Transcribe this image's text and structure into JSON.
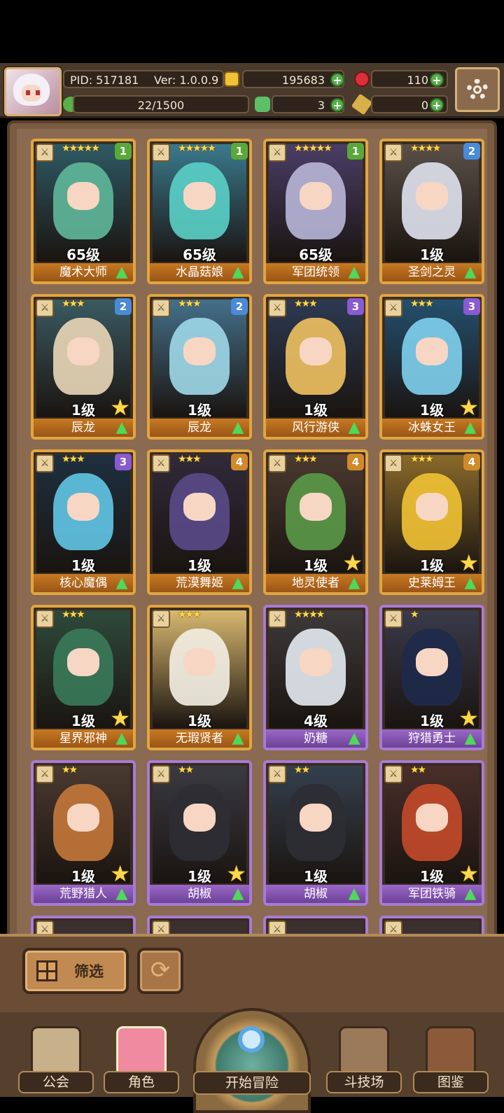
{
  "header": {
    "pid": "PID: 517181",
    "version": "Ver: 1.0.0.9",
    "energy": "22/1500",
    "gold": "195683",
    "gems": "110",
    "clover": "3",
    "keys": "0"
  },
  "roster": [
    {
      "stars": "★★★★★",
      "rank": "1",
      "rank_color": "#5aa83a",
      "level": "65级",
      "name": "魔术大师",
      "frame": "gold",
      "art": "#2e5a64",
      "char": "#5fb89a",
      "big_star": false
    },
    {
      "stars": "★★★★★",
      "rank": "1",
      "rank_color": "#5aa83a",
      "level": "65级",
      "name": "水晶菇娘",
      "frame": "gold",
      "art": "#3a7a8e",
      "char": "#5ad0c8",
      "big_star": false
    },
    {
      "stars": "★★★★★",
      "rank": "1",
      "rank_color": "#5aa83a",
      "level": "65级",
      "name": "军团统领",
      "frame": "gold",
      "art": "#4a3e66",
      "char": "#b8b6d8",
      "big_star": false
    },
    {
      "stars": "★★★★",
      "rank": "2",
      "rank_color": "#4a8ad6",
      "level": "1级",
      "name": "圣剑之灵",
      "frame": "gold",
      "art": "#5a5048",
      "char": "#dfe3ee",
      "big_star": false
    },
    {
      "stars": "★★★",
      "rank": "2",
      "rank_color": "#4a8ad6",
      "level": "1级",
      "name": "辰龙",
      "frame": "gold",
      "art": "#3a5a62",
      "char": "#ead7b8",
      "big_star": true
    },
    {
      "stars": "★★★",
      "rank": "2",
      "rank_color": "#4a8ad6",
      "level": "1级",
      "name": "辰龙",
      "frame": "gold",
      "art": "#44708a",
      "char": "#9fd8e8",
      "big_star": false
    },
    {
      "stars": "★★★",
      "rank": "3",
      "rank_color": "#8a5ad0",
      "level": "1级",
      "name": "风行游侠",
      "frame": "gold",
      "art": "#2c3a52",
      "char": "#f0c260",
      "big_star": false
    },
    {
      "stars": "★★★",
      "rank": "3",
      "rank_color": "#8a5ad0",
      "level": "1级",
      "name": "冰蛛女王",
      "frame": "gold",
      "art": "#24506e",
      "char": "#7fd0ee",
      "big_star": true
    },
    {
      "stars": "★★★",
      "rank": "3",
      "rank_color": "#8a5ad0",
      "level": "1级",
      "name": "核心魔偶",
      "frame": "gold",
      "art": "#1e3040",
      "char": "#62c6e6",
      "big_star": false
    },
    {
      "stars": "★★★",
      "rank": "4",
      "rank_color": "#d08a2a",
      "level": "1级",
      "name": "荒漠舞姬",
      "frame": "gold",
      "art": "#302a3a",
      "char": "#5a4a8a",
      "big_star": false
    },
    {
      "stars": "★★★",
      "rank": "4",
      "rank_color": "#d08a2a",
      "level": "1级",
      "name": "地灵使者",
      "frame": "gold",
      "art": "#4a3a30",
      "char": "#5a9a48",
      "big_star": true
    },
    {
      "stars": "★★★",
      "rank": "4",
      "rank_color": "#d08a2a",
      "level": "1级",
      "name": "史莱姆王",
      "frame": "gold",
      "art": "#8a6a2a",
      "char": "#f2c234",
      "big_star": true
    },
    {
      "stars": "★★★",
      "rank": "",
      "rank_color": "#3a3a6a",
      "level": "1级",
      "name": "星界邪神",
      "frame": "gold",
      "art": "#2e4a3a",
      "char": "#3a7a5a",
      "big_star": true
    },
    {
      "stars": "★★★",
      "rank": "",
      "rank_color": "",
      "level": "1级",
      "name": "无瑕贤者",
      "frame": "gold",
      "art": "#d8b870",
      "char": "#f4efe6",
      "big_star": false
    },
    {
      "stars": "★★★★",
      "rank": "",
      "rank_color": "",
      "level": "4级",
      "name": "奶糖",
      "frame": "purple",
      "art": "#3e3a3a",
      "char": "#e4ebf2",
      "big_star": false
    },
    {
      "stars": "★",
      "rank": "",
      "rank_color": "",
      "level": "1级",
      "name": "狩猎勇士",
      "frame": "purple",
      "art": "#3a3a4a",
      "char": "#1e2a4a",
      "big_star": true
    },
    {
      "stars": "★★",
      "rank": "",
      "rank_color": "",
      "level": "1级",
      "name": "荒野猎人",
      "frame": "purple",
      "art": "#4a3a30",
      "char": "#c4783a",
      "big_star": true
    },
    {
      "stars": "★★",
      "rank": "",
      "rank_color": "",
      "level": "1级",
      "name": "胡椒",
      "frame": "purple",
      "art": "#3a3a42",
      "char": "#2e2e34",
      "big_star": true
    },
    {
      "stars": "★★",
      "rank": "",
      "rank_color": "",
      "level": "1级",
      "name": "胡椒",
      "frame": "purple",
      "art": "#34404e",
      "char": "#2e2e34",
      "big_star": false
    },
    {
      "stars": "★★",
      "rank": "",
      "rank_color": "",
      "level": "1级",
      "name": "军团铁骑",
      "frame": "purple",
      "art": "#4a2e2a",
      "char": "#c44a2a",
      "big_star": true
    }
  ],
  "toolbar": {
    "filter_label": "筛选",
    "refresh_icon": "refresh-icon"
  },
  "nav": {
    "guild": "公会",
    "role": "角色",
    "adventure": "开始冒险",
    "arena": "斗技场",
    "codex": "图鉴"
  },
  "colors": {
    "frame_gold": "#e0a640",
    "frame_purple": "#a77bd6",
    "panel": "#7a5c42"
  }
}
